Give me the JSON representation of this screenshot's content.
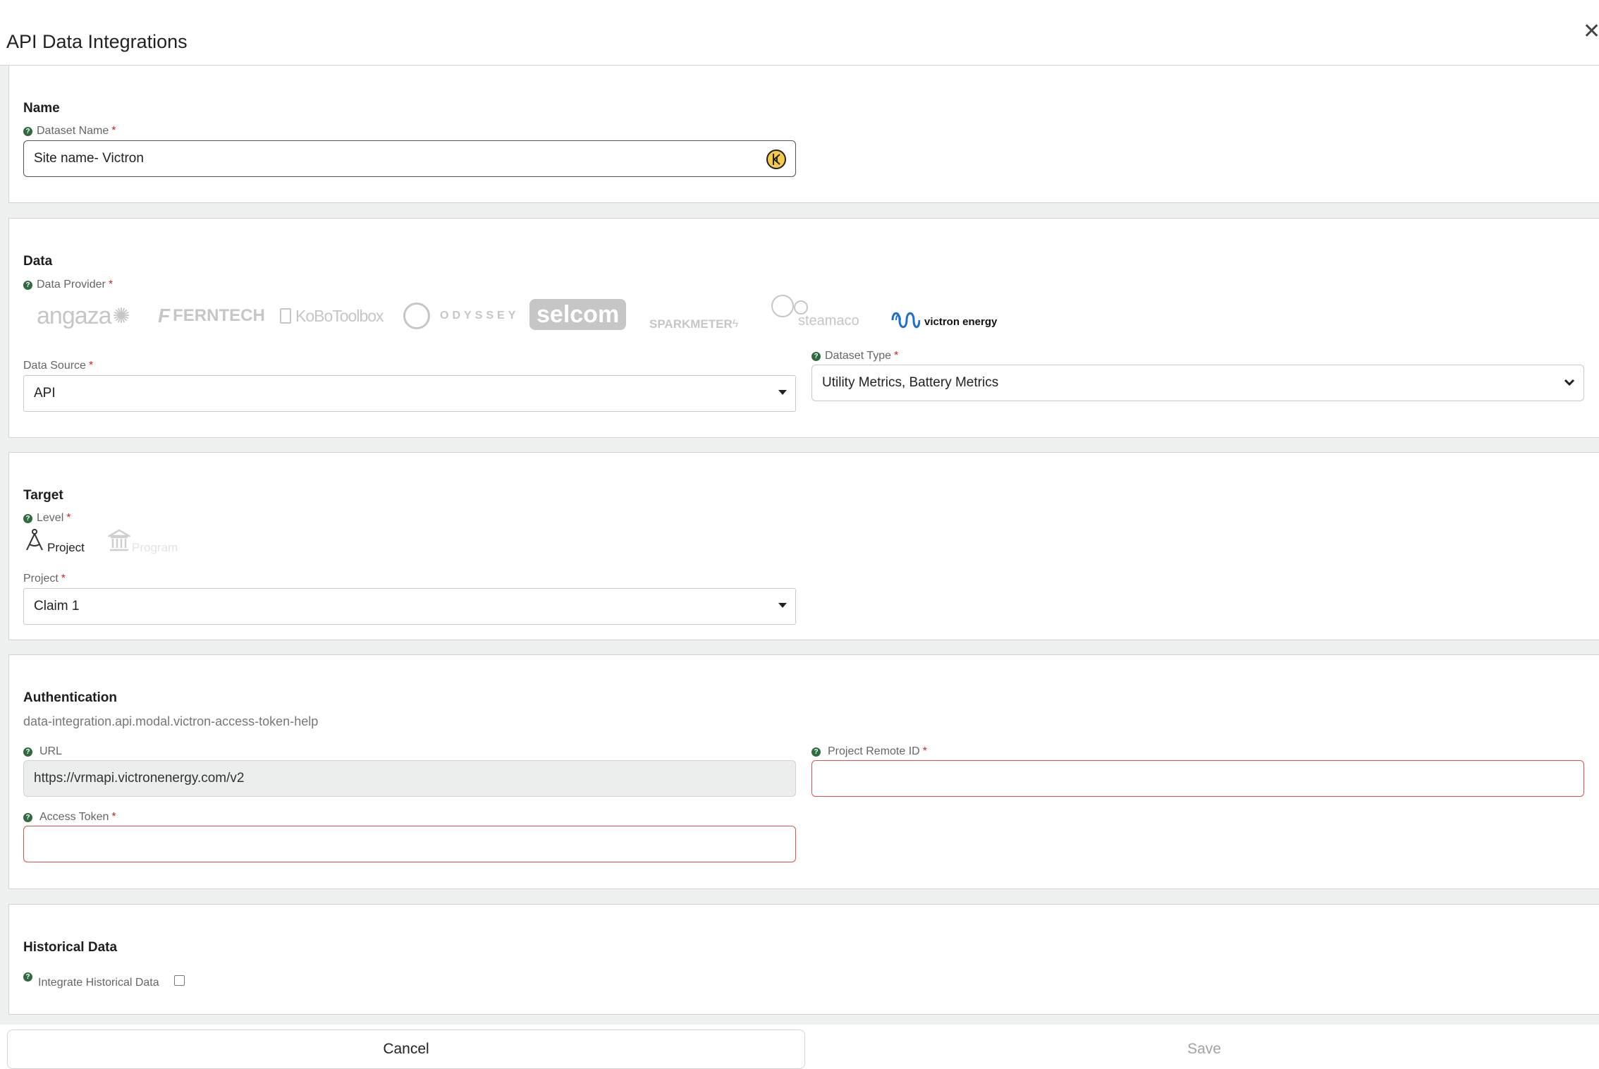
{
  "modal": {
    "title": "API Data Integrations"
  },
  "name_section": {
    "title": "Name",
    "dataset_name_label": "Dataset Name",
    "dataset_name_value": "Site name- Victron"
  },
  "data_section": {
    "title": "Data",
    "provider_label": "Data Provider",
    "providers": [
      {
        "label": "angaza",
        "selected": false
      },
      {
        "label": "FERNTECH",
        "selected": false
      },
      {
        "label": "KoBoToolbox",
        "selected": false
      },
      {
        "label": "ODYSSEY",
        "selected": false
      },
      {
        "label": "selcom",
        "selected": false
      },
      {
        "label": "SPARKMETER",
        "selected": false
      },
      {
        "label": "steamaco",
        "selected": false
      },
      {
        "label": "victron energy",
        "selected": true
      }
    ],
    "source_label": "Data Source",
    "source_value": "API",
    "type_label": "Dataset Type",
    "type_value": "Utility Metrics, Battery Metrics"
  },
  "target_section": {
    "title": "Target",
    "level_label": "Level",
    "levels": [
      {
        "label": "Project",
        "selected": true
      },
      {
        "label": "Program",
        "selected": false
      }
    ],
    "project_label": "Project",
    "project_value": "Claim 1"
  },
  "auth_section": {
    "title": "Authentication",
    "help_text": "data-integration.api.modal.victron-access-token-help",
    "url_label": "URL",
    "url_value": "https://vrmapi.victronenergy.com/v2",
    "remote_id_label": "Project Remote ID",
    "remote_id_value": "",
    "token_label": "Access Token",
    "token_value": ""
  },
  "history_section": {
    "title": "Historical Data",
    "checkbox_label": "Integrate Historical Data",
    "checked": false
  },
  "footer": {
    "cancel_label": "Cancel",
    "save_label": "Save"
  },
  "icons": {
    "help": "question-circle-icon",
    "close": "close-icon",
    "dropdown": "caret-down-icon",
    "project": "compass-icon",
    "program": "bank-icon",
    "extension": "keeper-extension-icon"
  },
  "colors": {
    "required": "#c62828",
    "help_icon": "#2e6b3e",
    "error_border": "#d9534f",
    "victron_blue": "#1b6fd3"
  }
}
